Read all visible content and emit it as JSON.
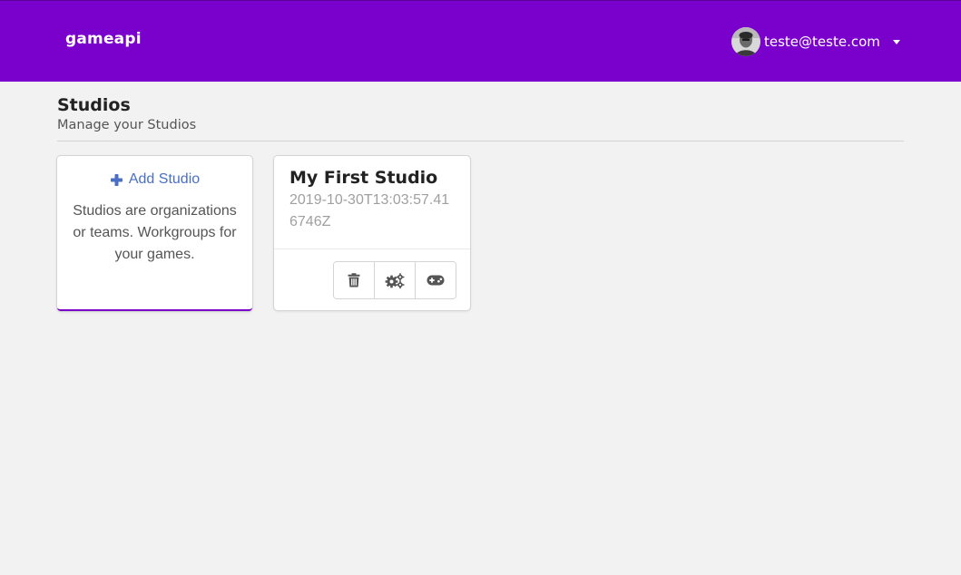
{
  "topbar": {
    "brand": "gameapi",
    "user": {
      "email": "teste@teste.com",
      "avatar_icon": "user-avatar",
      "dropdown_icon": "caret-down-icon"
    },
    "background_color": "#7a00cc"
  },
  "page": {
    "title": "Studios",
    "subtitle": "Manage your Studios"
  },
  "add_card": {
    "label": "Add Studio",
    "icon": "plus-icon",
    "description": "Studios are organizations or teams. Workgroups for your games.",
    "accent_color": "#4a6fc4"
  },
  "studios": [
    {
      "name": "My First Studio",
      "created_at": "2019-10-30T13:03:57.416746Z",
      "actions": [
        {
          "icon": "trash-icon"
        },
        {
          "icon": "cogs-icon"
        },
        {
          "icon": "gamepad-icon"
        }
      ]
    }
  ]
}
